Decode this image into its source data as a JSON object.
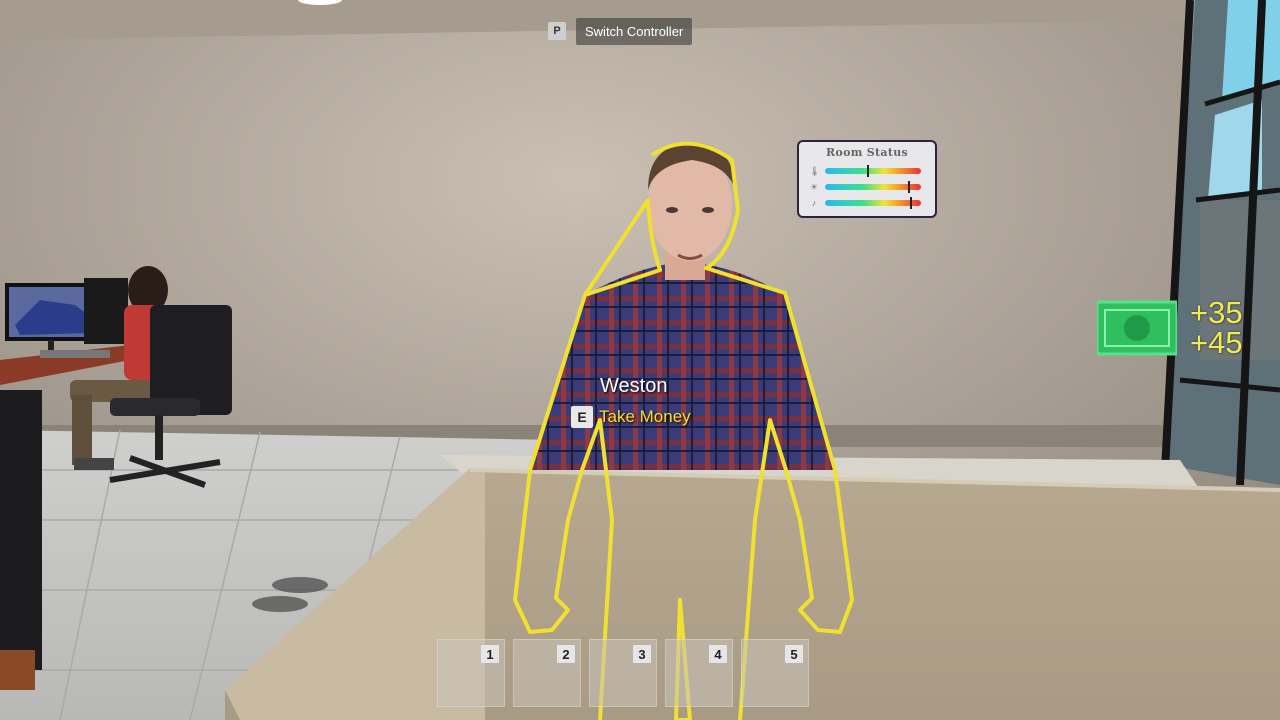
{
  "hud": {
    "switch_key": "P",
    "switch_label": "Switch Controller"
  },
  "room_status": {
    "title": "Room Status",
    "rows": [
      {
        "icon": "thermometer-icon",
        "level": 0.45
      },
      {
        "icon": "sun-icon",
        "level": 0.88
      },
      {
        "icon": "music-note-icon",
        "level": 0.9
      }
    ]
  },
  "money": {
    "gains": [
      "+35",
      "+45"
    ]
  },
  "customer": {
    "name": "Weston",
    "action_key": "E",
    "action_label": "Take Money"
  },
  "hotbar": {
    "slots": [
      "1",
      "2",
      "3",
      "4",
      "5"
    ]
  },
  "colors": {
    "outline": "#f0e030",
    "money": "#2fbf5f",
    "money_text": "#f0ec50"
  }
}
